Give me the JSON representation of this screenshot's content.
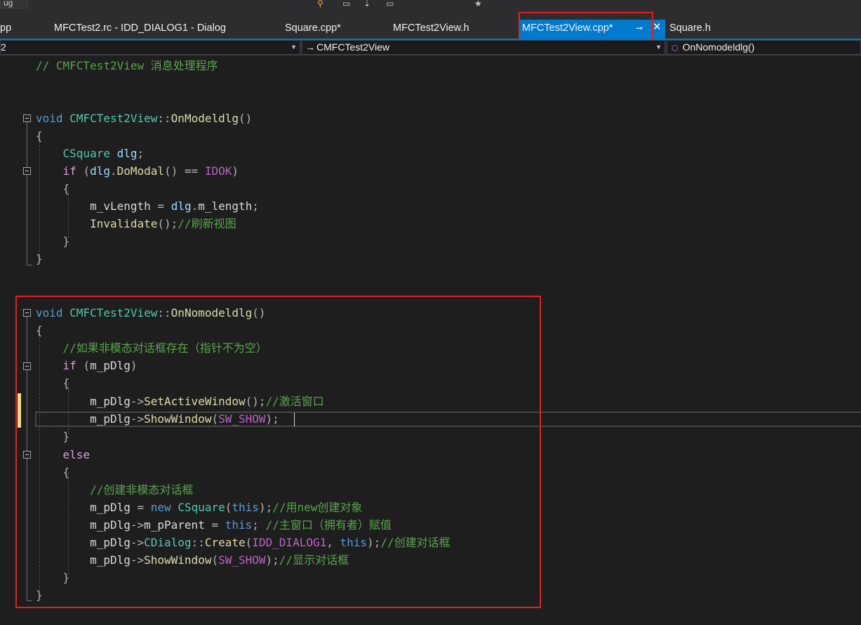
{
  "toolbar": {
    "config_combo": "ug"
  },
  "tabs": [
    {
      "label": "pp",
      "active": false
    },
    {
      "label": "MFCTest2.rc - IDD_DIALOG1 - Dialog",
      "active": false
    },
    {
      "label": "Square.cpp*",
      "active": false
    },
    {
      "label": "MFCTest2View.h",
      "active": false
    },
    {
      "label": "MFCTest2View.cpp*",
      "active": true
    },
    {
      "label": "Square.h",
      "active": false
    }
  ],
  "navbar": {
    "project": "2",
    "scope_class": "CMFCTest2View",
    "member": "OnNomodeldlg()"
  },
  "code": [
    "// CMFCTest2View 消息处理程序",
    "",
    "",
    "void CMFCTest2View::OnModeldlg()",
    "{",
    "    CSquare dlg;",
    "    if (dlg.DoModal() == IDOK)",
    "    {",
    "        m_vLength = dlg.m_length;",
    "        Invalidate();//刷新视图",
    "    }",
    "}",
    "",
    "",
    "void CMFCTest2View::OnNomodeldlg()",
    "{",
    "    //如果非模态对话框存在（指针不为空）",
    "    if (m_pDlg)",
    "    {",
    "        m_pDlg->SetActiveWindow();//激活窗口",
    "        m_pDlg->ShowWindow(SW_SHOW);",
    "    }",
    "    else",
    "    {",
    "        //创建非模态对话框",
    "        m_pDlg = new CSquare(this);//用new创建对象",
    "        m_pDlg->m_pParent = this; //主窗口（拥有者）赋值",
    "        m_pDlg->CDialog::Create(IDD_DIALOG1, this);//创建对话框",
    "        m_pDlg->ShowWindow(SW_SHOW);//显示对话框",
    "    }",
    "}"
  ]
}
